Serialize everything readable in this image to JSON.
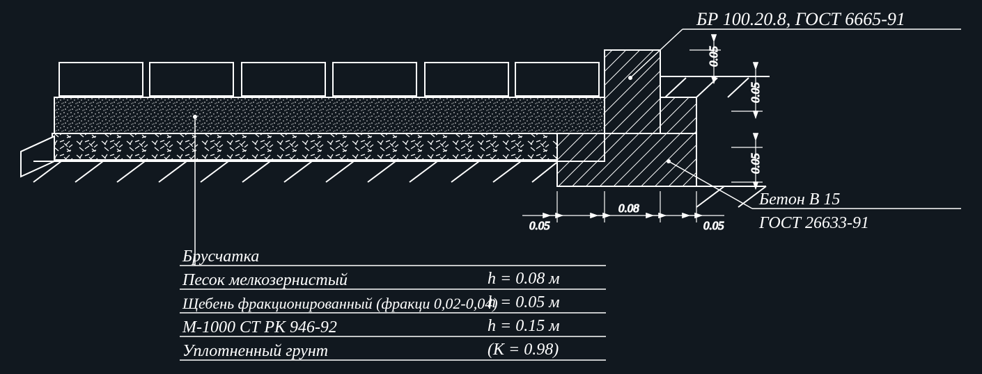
{
  "callouts": {
    "top_right": "БР 100.20.8, ГОСТ 6665-91",
    "bottom_right_1": "Бетон В 15",
    "bottom_right_2": "ГОСТ 26633-91"
  },
  "dimensions": {
    "top_gap": "0.05",
    "right_1": "0.05",
    "right_2": "0.05",
    "bottom_left": "0.05",
    "bottom_mid": "0.08",
    "bottom_right": "0.05"
  },
  "legend": {
    "row1": {
      "label": "Брусчатка",
      "value": ""
    },
    "row2": {
      "label": "Песок мелкозернистый",
      "value": "h = 0.08 м"
    },
    "row3": {
      "label": "Щебень фракционированный (фракци 0,02-0,04)",
      "value": "h = 0.05 м"
    },
    "row4": {
      "label": "М-1000  СТ РК 946-92",
      "value": "h = 0.15 м"
    },
    "row5": {
      "label": "Уплотненный грунт",
      "value": "(K = 0.98)"
    }
  }
}
